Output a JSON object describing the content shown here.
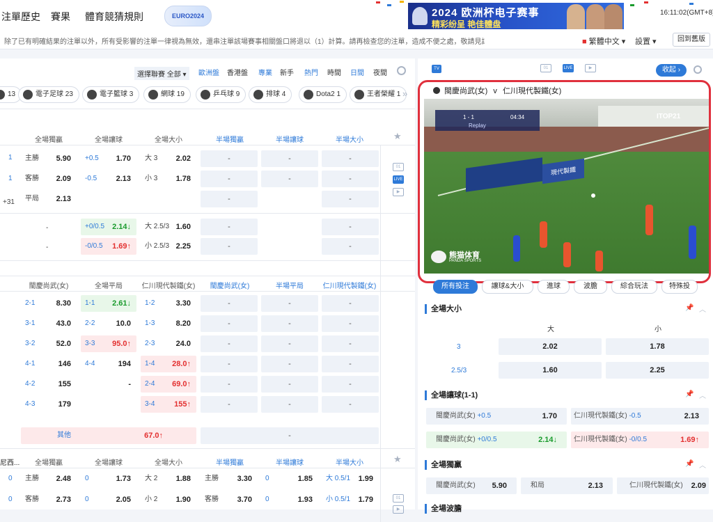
{
  "header": {
    "nav": [
      "注單歷史",
      "賽果",
      "體育競猜規則"
    ],
    "euro_logo": "EURO2024",
    "banner_title": "2024 欧洲杯电子赛事",
    "banner_sub": "精彩纷呈 艳佳體盘",
    "clock": "16:11:02(GMT+8)"
  },
  "notice": {
    "text": "除了已有明確結果的注單以外，所有受影響的注單一律視為無效，還串注單該場賽事相關盤口將退以（1）計算。請再檢查您的注單，造成不便之處，敬請見諒。　　　歐",
    "language": "繁體中文",
    "settings": "設置",
    "back": "回到舊版"
  },
  "filters": {
    "league": "選擇聯賽 全部",
    "european": "歐洲盤",
    "hk": "香港盤",
    "pro": "專業",
    "novice": "新手",
    "hot": "熱門",
    "time": "時間",
    "day": "日間",
    "night": "夜間"
  },
  "sports": [
    {
      "label": "13",
      "icon": "ball-icon"
    },
    {
      "label": "電子足球 23",
      "icon": "esoccer-icon"
    },
    {
      "label": "電子籃球 3",
      "icon": "ebasketball-icon"
    },
    {
      "label": "網球 19",
      "icon": "tennis-icon"
    },
    {
      "label": "乒乓球 9",
      "icon": "pingpong-icon"
    },
    {
      "label": "排球 4",
      "icon": "volleyball-icon"
    },
    {
      "label": "Dota2 1",
      "icon": "dota-icon"
    },
    {
      "label": "王者榮耀 1",
      "icon": "honor-icon"
    }
  ],
  "table1": {
    "headers": [
      "全場獨贏",
      "全場讓球",
      "全場大小",
      "半場獨贏",
      "半場讓球",
      "半場大小"
    ],
    "side": [
      "1",
      "1",
      "+31"
    ],
    "rows": [
      {
        "label": "主勝",
        "odds": "5.90",
        "hcp": "+0.5",
        "hcp_odds": "1.70",
        "ou": "大 3",
        "ou_odds": "2.02"
      },
      {
        "label": "客勝",
        "odds": "2.09",
        "hcp": "-0.5",
        "hcp_odds": "2.13",
        "ou": "小 3",
        "ou_odds": "1.78"
      },
      {
        "label": "平局",
        "odds": "2.13"
      }
    ],
    "extra": [
      {
        "left": "-",
        "hcp": "+0/0.5",
        "hcp_odds": "2.14",
        "ou": "大 2.5/3",
        "ou_odds": "1.60"
      },
      {
        "left": "-",
        "hcp": "-0/0.5",
        "hcp_odds": "1.69",
        "ou": "小 2.5/3",
        "ou_odds": "2.25"
      }
    ],
    "dash": "-"
  },
  "table2": {
    "headers": [
      "閩慶尚武(女)",
      "全場平局",
      "仁川現代製鐵(女)",
      "閩慶尚武(女)",
      "半場平局",
      "仁川現代製鐵(女)"
    ],
    "rows": [
      {
        "h": "2-1",
        "ho": "8.30",
        "d": "1-1",
        "do": "2.61",
        "a": "1-2",
        "ao": "3.30"
      },
      {
        "h": "3-1",
        "ho": "43.0",
        "d": "2-2",
        "do": "10.0",
        "a": "1-3",
        "ao": "8.20"
      },
      {
        "h": "3-2",
        "ho": "52.0",
        "d": "3-3",
        "do": "95.0",
        "a": "2-3",
        "ao": "24.0"
      },
      {
        "h": "4-1",
        "ho": "146",
        "d": "4-4",
        "do": "194",
        "a": "1-4",
        "ao": "28.0"
      },
      {
        "h": "4-2",
        "ho": "155",
        "d": "",
        "do": "-",
        "a": "2-4",
        "ao": "69.0"
      },
      {
        "h": "4-3",
        "ho": "179",
        "d": "",
        "do": "",
        "a": "3-4",
        "ao": "155"
      }
    ],
    "other_label": "其他",
    "other_odds": "67.0"
  },
  "table3": {
    "league": "尼西...",
    "headers": [
      "全場獨贏",
      "全場讓球",
      "全場大小",
      "半場獨贏",
      "半場讓球",
      "半場大小"
    ],
    "rows": [
      {
        "side": "0",
        "label": "主勝",
        "odds": "2.48",
        "hcp": "0",
        "hcp_odds": "1.73",
        "ou": "大 2",
        "ou_odds": "1.88",
        "hlabel": "主勝",
        "hodds": "3.30",
        "hhcp": "0",
        "hhcp_odds": "1.85",
        "hou": "大 0.5/1",
        "hou_odds": "1.99"
      },
      {
        "side": "0",
        "label": "客勝",
        "odds": "2.73",
        "hcp": "0",
        "hcp_odds": "2.05",
        "ou": "小 2",
        "ou_odds": "1.90",
        "hlabel": "客勝",
        "hodds": "3.70",
        "hhcp": "0",
        "hhcp_odds": "1.93",
        "hou": "小 0.5/1",
        "hou_odds": "1.79"
      }
    ]
  },
  "right": {
    "collapse": "收起",
    "home": "閩慶尚武(女)",
    "vs": "v",
    "away": "仁川現代製鐵(女)",
    "video": {
      "score": "1 - 1",
      "time": "04:34",
      "replay": "Replay",
      "sponsor": "ITOP21",
      "panda": "熊猫体育",
      "panda_en": "PANDA SPORTS",
      "board": "現代製鐵"
    },
    "market_tabs": [
      "所有投注",
      "讓球&大小",
      "進球",
      "波膽",
      "綜合玩法",
      "特殊投"
    ],
    "ou": {
      "title": "全場大小",
      "over": "大",
      "under": "小",
      "rows": [
        {
          "line": "3",
          "over": "2.02",
          "under": "1.78"
        },
        {
          "line": "2.5/3",
          "over": "1.60",
          "under": "2.25"
        }
      ]
    },
    "hcp": {
      "title": "全場讓球(1-1)",
      "rows": [
        {
          "home": "閩慶尚武(女)",
          "hline": "+0.5",
          "hodds": "1.70",
          "away": "仁川現代製鐵(女)",
          "aline": "-0.5",
          "aodds": "2.13"
        },
        {
          "home": "閩慶尚武(女)",
          "hline": "+0/0.5",
          "hodds": "2.14",
          "away": "仁川現代製鐵(女)",
          "aline": "-0/0.5",
          "aodds": "1.69"
        }
      ]
    },
    "mw": {
      "title": "全場獨贏",
      "home": "閩慶尚武(女)",
      "home_odds": "5.90",
      "draw": "和局",
      "draw_odds": "2.13",
      "away": "仁川現代製鐵(女)",
      "away_odds": "2.09"
    },
    "next_title": "全場波膽"
  },
  "colors": {
    "accent": "#2e7ad8",
    "up": "#e33030",
    "down": "#1a9b2d",
    "highlight": "#e0303d"
  }
}
